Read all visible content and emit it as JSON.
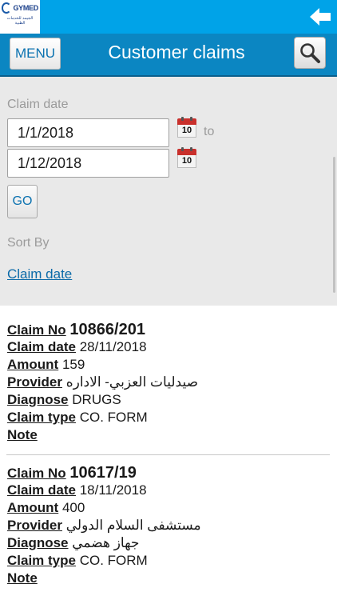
{
  "logo": {
    "brand": "GYMED",
    "tagline": "الجيمد للخدمات الطبية"
  },
  "header": {
    "menu_label": "MENU",
    "title": "Customer claims"
  },
  "filter": {
    "claim_date_label": "Claim date",
    "from_date": "1/1/2018",
    "to_label": "to",
    "to_date": "1/12/2018",
    "calendar_day": "10",
    "go_label": "GO",
    "sort_by_label": "Sort By",
    "sort_option": "Claim date"
  },
  "labels": {
    "claim_no": "Claim No",
    "claim_date": "Claim date",
    "amount": "Amount",
    "provider": "Provider",
    "diagnose": "Diagnose",
    "claim_type": "Claim type",
    "note": "Note"
  },
  "claims": [
    {
      "claim_no": "10866/201",
      "claim_date": "28/11/2018",
      "amount": "159",
      "provider": "صيدليات العزبي- الاداره",
      "diagnose": "DRUGS",
      "claim_type": "CO. FORM",
      "note": ""
    },
    {
      "claim_no": "10617/19",
      "claim_date": "18/11/2018",
      "amount": "400",
      "provider": "مستشفى السلام الدولي",
      "diagnose": "جهاز هضمي",
      "claim_type": "CO. FORM",
      "note": ""
    }
  ],
  "colors": {
    "top_bar": "#00a3e8",
    "header": "#0b86c2",
    "link": "#0b6aa8",
    "panel": "#e9e9e9"
  }
}
